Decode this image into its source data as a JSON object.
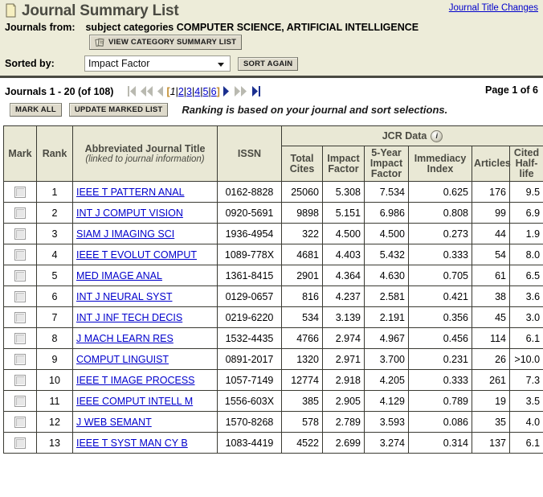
{
  "header": {
    "title": "Journal Summary List",
    "title_icon": "journal-page-icon",
    "title_changes_link": "Journal Title Changes",
    "from_label": "Journals from:",
    "from_value": "subject categories COMPUTER SCIENCE, ARTIFICIAL INTELLIGENCE",
    "view_category_button": "VIEW CATEGORY SUMMARY LIST",
    "view_category_icon": "books-stack-icon",
    "sorted_by_label": "Sorted by:",
    "sort_value": "Impact Factor",
    "sort_options": [
      "Impact Factor"
    ],
    "sort_again_button": "SORT AGAIN"
  },
  "pagination": {
    "count_label": "Journals 1 - 20 (of 108)",
    "open_bracket": "[",
    "close_bracket": "]",
    "current_page_number": "1",
    "pages": [
      "2",
      "3",
      "4",
      "5",
      "6"
    ],
    "separator": "|",
    "page_of": "Page 1 of 6",
    "first_icon": "first-page-icon",
    "prev_jump_icon": "prev-jump-icon",
    "prev_icon": "prev-page-icon",
    "next_icon": "next-page-icon",
    "next_jump_icon": "next-jump-icon",
    "last_icon": "last-page-icon"
  },
  "actions": {
    "mark_all_button": "MARK ALL",
    "update_marked_button": "UPDATE MARKED LIST",
    "ranking_note": "Ranking is based on your journal and sort selections."
  },
  "table": {
    "group_header": "JCR Data",
    "group_header_icon": "info-icon",
    "columns": {
      "mark": "Mark",
      "rank": "Rank",
      "title": "Abbreviated Journal Title",
      "title_sub": "(linked to journal information)",
      "issn": "ISSN",
      "total_cites": "Total Cites",
      "impact_factor": "Impact Factor",
      "five_year": "5-Year Impact Factor",
      "immediacy": "Immediacy Index",
      "articles": "Articles",
      "cited_half_life": "Cited Half-life"
    },
    "rows": [
      {
        "rank": "1",
        "title": "IEEE T PATTERN ANAL",
        "issn": "0162-8828",
        "total_cites": "25060",
        "impact_factor": "5.308",
        "five_year": "7.534",
        "immediacy": "0.625",
        "articles": "176",
        "half_life": "9.5"
      },
      {
        "rank": "2",
        "title": "INT J COMPUT VISION",
        "issn": "0920-5691",
        "total_cites": "9898",
        "impact_factor": "5.151",
        "five_year": "6.986",
        "immediacy": "0.808",
        "articles": "99",
        "half_life": "6.9"
      },
      {
        "rank": "3",
        "title": "SIAM J IMAGING SCI",
        "issn": "1936-4954",
        "total_cites": "322",
        "impact_factor": "4.500",
        "five_year": "4.500",
        "immediacy": "0.273",
        "articles": "44",
        "half_life": "1.9"
      },
      {
        "rank": "4",
        "title": "IEEE T EVOLUT COMPUT",
        "issn": "1089-778X",
        "total_cites": "4681",
        "impact_factor": "4.403",
        "five_year": "5.432",
        "immediacy": "0.333",
        "articles": "54",
        "half_life": "8.0"
      },
      {
        "rank": "5",
        "title": "MED IMAGE ANAL",
        "issn": "1361-8415",
        "total_cites": "2901",
        "impact_factor": "4.364",
        "five_year": "4.630",
        "immediacy": "0.705",
        "articles": "61",
        "half_life": "6.5"
      },
      {
        "rank": "6",
        "title": "INT J NEURAL SYST",
        "issn": "0129-0657",
        "total_cites": "816",
        "impact_factor": "4.237",
        "five_year": "2.581",
        "immediacy": "0.421",
        "articles": "38",
        "half_life": "3.6"
      },
      {
        "rank": "7",
        "title": "INT J INF TECH DECIS",
        "issn": "0219-6220",
        "total_cites": "534",
        "impact_factor": "3.139",
        "five_year": "2.191",
        "immediacy": "0.356",
        "articles": "45",
        "half_life": "3.0"
      },
      {
        "rank": "8",
        "title": "J MACH LEARN RES",
        "issn": "1532-4435",
        "total_cites": "4766",
        "impact_factor": "2.974",
        "five_year": "4.967",
        "immediacy": "0.456",
        "articles": "114",
        "half_life": "6.1"
      },
      {
        "rank": "9",
        "title": "COMPUT LINGUIST",
        "issn": "0891-2017",
        "total_cites": "1320",
        "impact_factor": "2.971",
        "five_year": "3.700",
        "immediacy": "0.231",
        "articles": "26",
        "half_life": ">10.0"
      },
      {
        "rank": "10",
        "title": "IEEE T IMAGE PROCESS",
        "issn": "1057-7149",
        "total_cites": "12774",
        "impact_factor": "2.918",
        "five_year": "4.205",
        "immediacy": "0.333",
        "articles": "261",
        "half_life": "7.3"
      },
      {
        "rank": "11",
        "title": "IEEE COMPUT INTELL M",
        "issn": "1556-603X",
        "total_cites": "385",
        "impact_factor": "2.905",
        "five_year": "4.129",
        "immediacy": "0.789",
        "articles": "19",
        "half_life": "3.5"
      },
      {
        "rank": "12",
        "title": "J WEB SEMANT",
        "issn": "1570-8268",
        "total_cites": "578",
        "impact_factor": "2.789",
        "five_year": "3.593",
        "immediacy": "0.086",
        "articles": "35",
        "half_life": "4.0"
      },
      {
        "rank": "13",
        "title": "IEEE T SYST MAN CY B",
        "issn": "1083-4419",
        "total_cites": "4522",
        "impact_factor": "2.699",
        "five_year": "3.274",
        "immediacy": "0.314",
        "articles": "137",
        "half_life": "6.1"
      }
    ]
  },
  "colors": {
    "panel_bg": "#edecd9",
    "table_header_bg": "#e9e8d5",
    "impact_factor_highlight": "#faf8dc",
    "link": "#0000cc",
    "header_text": "#4a4a42",
    "arrow_active": "#1a2f8f",
    "arrow_disabled": "#b9b9b0"
  }
}
